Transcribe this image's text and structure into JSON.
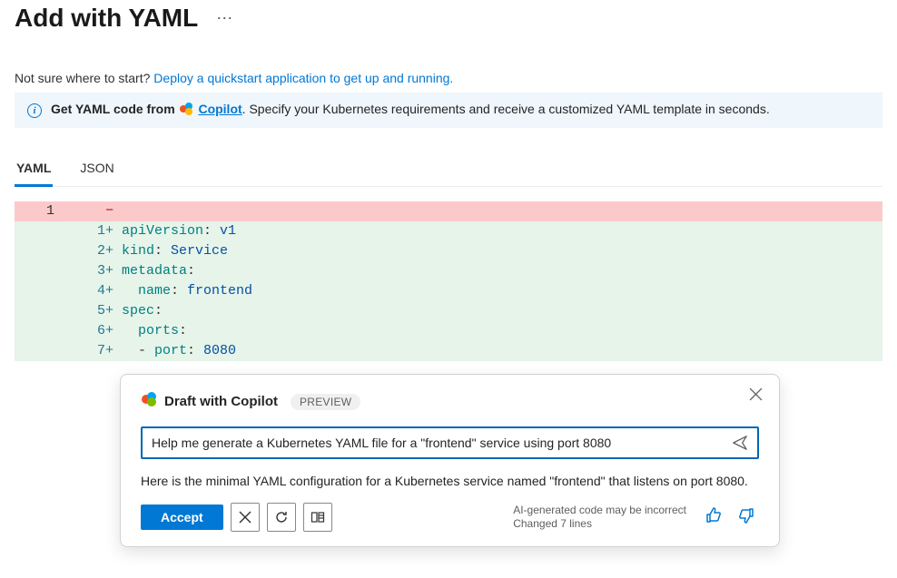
{
  "header": {
    "title": "Add with YAML"
  },
  "help": {
    "prefix": "Not sure where to start? ",
    "link_text": "Deploy a quickstart application to get up and running."
  },
  "banner": {
    "lead": "Get YAML code from",
    "copilot_label": "Copilot",
    "tail": ". Specify your Kubernetes requirements and receive a customized YAML template in seconds."
  },
  "tabs": {
    "yaml": "YAML",
    "json": "JSON"
  },
  "diff": {
    "removed_line_no": "1",
    "lines": [
      {
        "n": "1",
        "code_html": "<span class=\"key\">apiVersion</span>: <span class=\"val\">v1</span>"
      },
      {
        "n": "2",
        "code_html": "<span class=\"key\">kind</span>: <span class=\"val\">Service</span>"
      },
      {
        "n": "3",
        "code_html": "<span class=\"key\">metadata</span>:"
      },
      {
        "n": "4",
        "code_html": "  <span class=\"key\">name</span>: <span class=\"val\">frontend</span>"
      },
      {
        "n": "5",
        "code_html": "<span class=\"key\">spec</span>:"
      },
      {
        "n": "6",
        "code_html": "  <span class=\"key\">ports</span>:"
      },
      {
        "n": "7",
        "code_html": "  - <span class=\"key\">port</span>: <span class=\"val\">8080</span>"
      }
    ]
  },
  "popup": {
    "title": "Draft with Copilot",
    "preview_badge": "PREVIEW",
    "prompt_value": "Help me generate a Kubernetes YAML file for a \"frontend\" service using port 8080",
    "response": "Here is the minimal YAML configuration for a Kubernetes service named \"frontend\" that listens on port 8080.",
    "accept_label": "Accept",
    "disclaimer_line1": "AI-generated code may be incorrect",
    "disclaimer_line2": "Changed 7 lines"
  }
}
